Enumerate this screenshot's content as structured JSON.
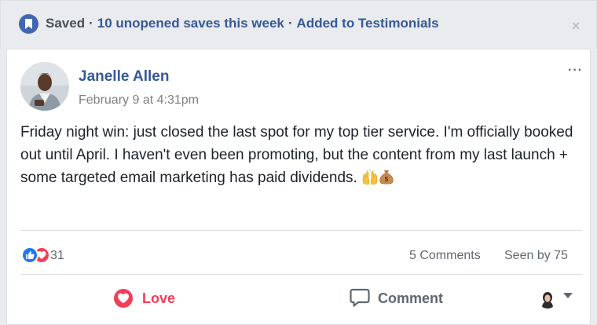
{
  "banner": {
    "saved_label": "Saved",
    "separator": "·",
    "unopened_saves": "10 unopened saves this week",
    "collection": "Added to Testimonials",
    "close_label": "×"
  },
  "post": {
    "author": "Janelle Allen",
    "timestamp": "February 9 at 4:31pm",
    "more_label": "···",
    "body": "Friday night win: just closed the last spot for my top tier service. I'm officially booked out until April. I haven't even been promoting, but the content from my last launch + some targeted email marketing has paid dividends.",
    "emojis": [
      "raising-hands",
      "money-bag"
    ]
  },
  "stats": {
    "reaction_count": "31",
    "reaction_types": [
      "like",
      "love"
    ],
    "comments": "5 Comments",
    "seen_by": "Seen by 75"
  },
  "actions": {
    "love_label": "Love",
    "comment_label": "Comment"
  },
  "colors": {
    "link_blue": "#365899",
    "accent_blue": "#4267b2",
    "love_red": "#f33e58",
    "like_blue": "#2078f4",
    "muted_text": "#606770",
    "page_bg": "#e9ebee"
  }
}
